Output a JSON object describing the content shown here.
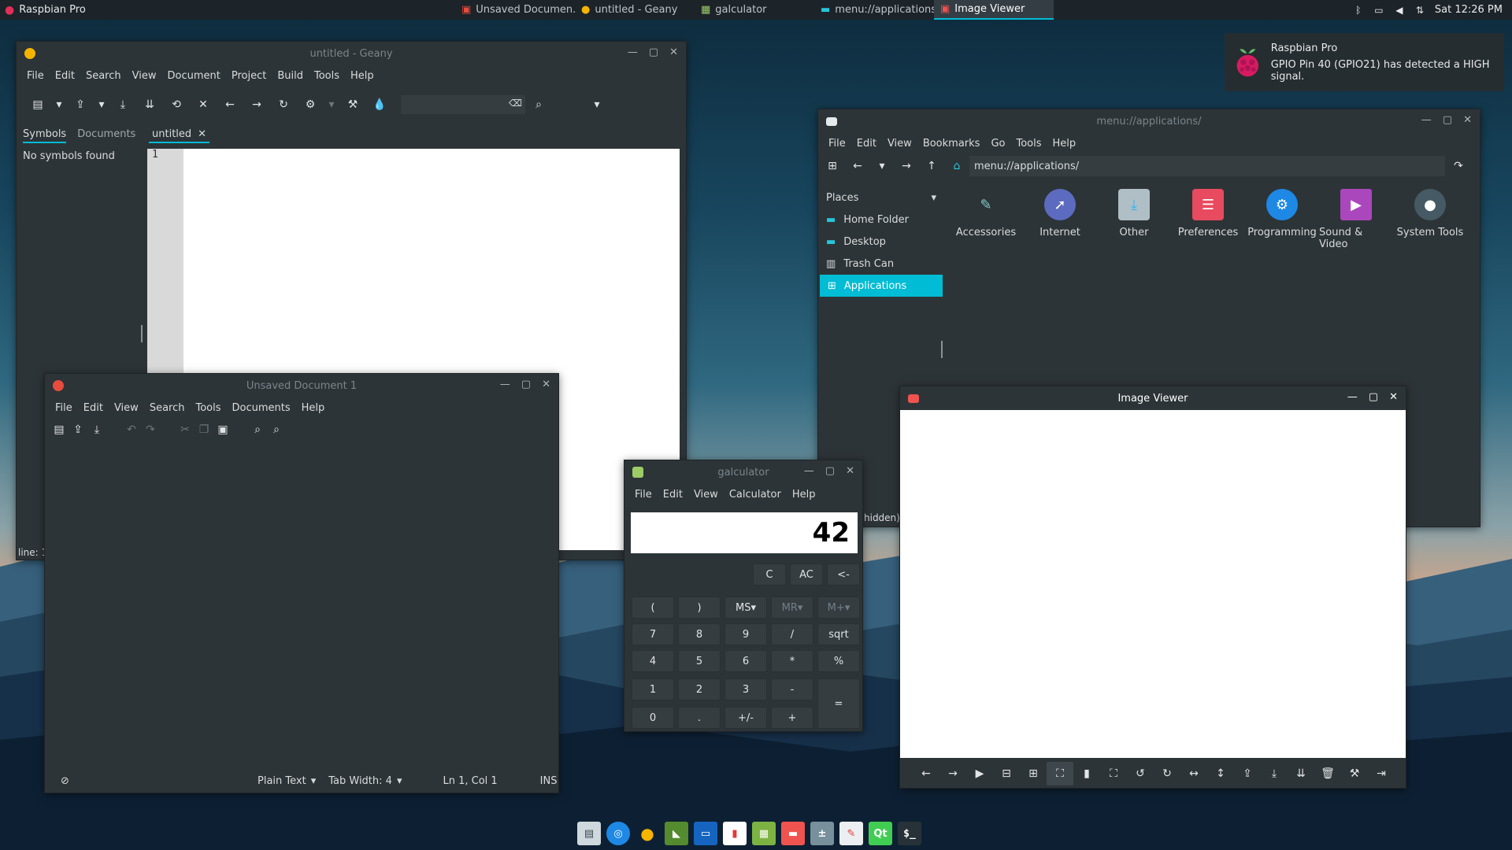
{
  "panel": {
    "start_label": "Raspbian Pro",
    "tasks": [
      {
        "label": "Unsaved Documen...",
        "active": false
      },
      {
        "label": "untitled - Geany",
        "active": false
      },
      {
        "label": "galculator",
        "active": false
      },
      {
        "label": "menu://applications/",
        "active": false
      },
      {
        "label": "Image Viewer",
        "active": true
      }
    ],
    "clock": "Sat 12:26 PM"
  },
  "notification": {
    "title": "Raspbian Pro",
    "body": "GPIO Pin 40 (GPIO21) has detected a HIGH signal."
  },
  "geany": {
    "title": "untitled - Geany",
    "menu": [
      "File",
      "Edit",
      "Search",
      "View",
      "Document",
      "Project",
      "Build",
      "Tools",
      "Help"
    ],
    "side_tabs": [
      "Symbols",
      "Documents"
    ],
    "doc_tab": "untitled",
    "side_text": "No symbols found",
    "line_number": "1",
    "status": "line: 1"
  },
  "mousepad": {
    "title": "Unsaved Document 1",
    "menu": [
      "File",
      "Edit",
      "View",
      "Search",
      "Tools",
      "Documents",
      "Help"
    ],
    "status": {
      "syntax": "Plain Text",
      "tab_width": "Tab Width:  4",
      "position": "Ln 1, Col 1",
      "mode": "INS"
    }
  },
  "galculator": {
    "title": "galculator",
    "menu": [
      "File",
      "Edit",
      "View",
      "Calculator",
      "Help"
    ],
    "display": "42",
    "keys": {
      "c": "C",
      "ac": "AC",
      "bs": "<-",
      "lp": "(",
      "rp": ")",
      "ms": "MS",
      "mr": "MR",
      "mp": "M+",
      "k7": "7",
      "k8": "8",
      "k9": "9",
      "div": "/",
      "sqrt": "sqrt",
      "k4": "4",
      "k5": "5",
      "k6": "6",
      "mul": "*",
      "pct": "%",
      "k1": "1",
      "k2": "2",
      "k3": "3",
      "sub": "-",
      "eq": "=",
      "k0": "0",
      "dot": ".",
      "neg": "+/-",
      "add": "+"
    }
  },
  "filemanager": {
    "title": "menu://applications/",
    "menu": [
      "File",
      "Edit",
      "View",
      "Bookmarks",
      "Go",
      "Tools",
      "Help"
    ],
    "path": "menu://applications/",
    "places_label": "Places",
    "places": [
      {
        "label": "Home Folder",
        "icon": "home-folder-icon"
      },
      {
        "label": "Desktop",
        "icon": "desktop-icon"
      },
      {
        "label": "Trash Can",
        "icon": "trash-icon"
      },
      {
        "label": "Applications",
        "icon": "applications-icon",
        "selected": true
      }
    ],
    "apps": [
      {
        "label": "Accessories",
        "icon": "accessories-icon",
        "color": "#3a4a52"
      },
      {
        "label": "Internet",
        "icon": "internet-icon",
        "color": "#5c6bc0"
      },
      {
        "label": "Other",
        "icon": "other-icon",
        "color": "#b0bec5"
      },
      {
        "label": "Preferences",
        "icon": "preferences-icon",
        "color": "#e84a5f"
      },
      {
        "label": "Programming",
        "icon": "programming-icon",
        "color": "#1e88e5"
      },
      {
        "label": "Sound & Video",
        "icon": "sound-video-icon",
        "color": "#ab47bc"
      },
      {
        "label": "System Tools",
        "icon": "system-tools-icon",
        "color": "#455a64"
      }
    ],
    "status_fragment": "hidden)"
  },
  "imageviewer": {
    "title": "Image Viewer"
  },
  "colors": {
    "accent": "#00bcd4",
    "window_bg": "#2d3437",
    "panel_bg": "#1c2329"
  }
}
